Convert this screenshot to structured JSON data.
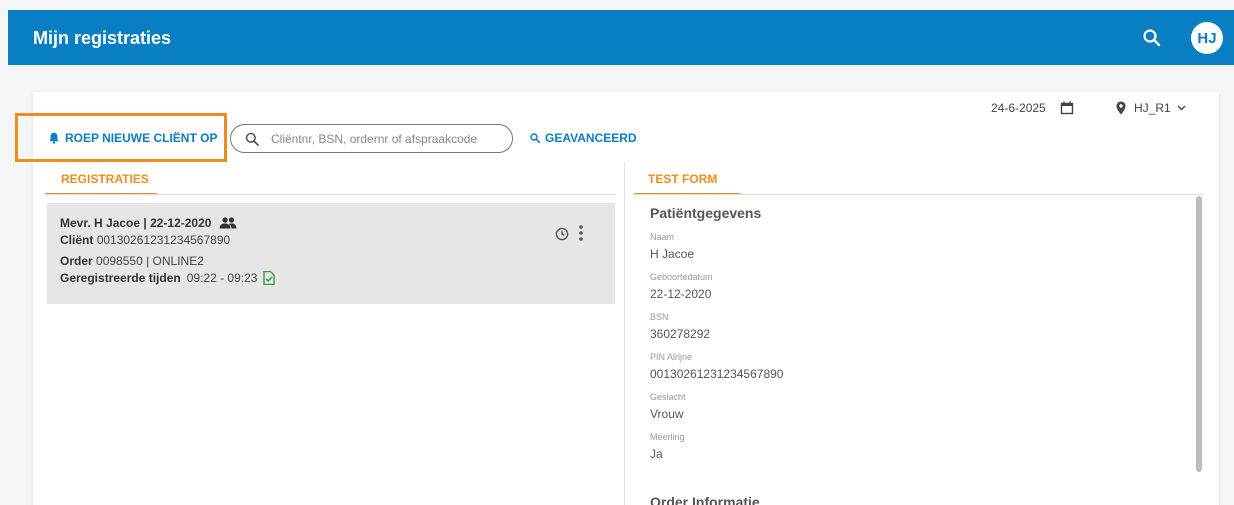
{
  "header": {
    "title": "Mijn registraties",
    "avatar_initials": "HJ"
  },
  "toolbar": {
    "date": "24-6-2025",
    "location": "HJ_R1",
    "call_client_label": "ROEP NIEUWE CLIËNT OP",
    "search_placeholder": "Cliëntnr, BSN, ordernr of afspraakcode",
    "advanced_label": "GEAVANCEERD"
  },
  "tabs": {
    "left": "REGISTRATIES",
    "right": "TEST FORM"
  },
  "registration": {
    "title": "Mevr. H Jacoe | 22-12-2020",
    "client_label": "Cliënt",
    "client_value": "00130261231234567890",
    "order_label": "Order",
    "order_value": "0098550 | ONLINE2",
    "times_label": "Geregistreerde tijden",
    "times_value": "09:22 - 09:23"
  },
  "form": {
    "section_title": "Patiëntgegevens",
    "fields": [
      {
        "label": "Naam",
        "value": "H Jacoe"
      },
      {
        "label": "Geboortedatum",
        "value": "22-12-2020"
      },
      {
        "label": "BSN",
        "value": "360278292"
      },
      {
        "label": "PIN Alrijne",
        "value": "00130261231234567890"
      },
      {
        "label": "Geslacht",
        "value": "Vrouw"
      },
      {
        "label": "Meerling",
        "value": "Ja"
      }
    ],
    "section2_title": "Order Informatie"
  },
  "colors": {
    "primary": "#0a7ec2",
    "accent": "#f08c1e",
    "item_bg": "#e6e6e6",
    "success": "#3a9d3a"
  },
  "icons": [
    "search-icon",
    "calendar-icon",
    "location-pin-icon",
    "chevron-down-icon",
    "bell-icon",
    "group-icon",
    "clock-icon",
    "more-vertical-icon",
    "document-check-icon"
  ]
}
